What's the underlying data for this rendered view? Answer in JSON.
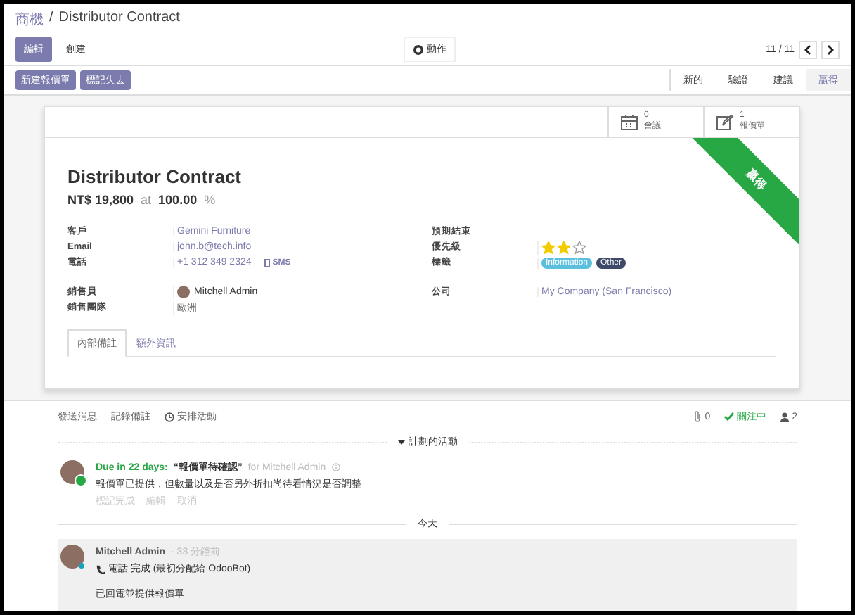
{
  "breadcrumb": {
    "parent": "商機",
    "separator": "/",
    "current": "Distributor Contract"
  },
  "toolbar": {
    "edit": "編輯",
    "create": "創建",
    "action": "動作",
    "pager": "11 / 11"
  },
  "status_buttons": [
    "新建報價單",
    "標記失去"
  ],
  "stages": [
    {
      "label": "新的",
      "selected": false
    },
    {
      "label": "驗證",
      "selected": false
    },
    {
      "label": "建議",
      "selected": false
    },
    {
      "label": "贏得",
      "selected": true
    }
  ],
  "smart_buttons": [
    {
      "kind": "calendar",
      "count": "0",
      "label": "會議"
    },
    {
      "kind": "quote",
      "count": "1",
      "label": "報價單"
    }
  ],
  "ribbon": "贏得",
  "title": "Distributor Contract",
  "revenue": {
    "amount": "NT$ 19,800",
    "at": "at",
    "probability": "100.00",
    "unit": "%"
  },
  "left_fields": [
    {
      "label": "客戶",
      "value": "Gemini Furniture",
      "kind": "link"
    },
    {
      "label": "Email",
      "value": "john.b@tech.info",
      "kind": "link"
    },
    {
      "label": "電話",
      "value": "+1 312 349 2324",
      "kind": "phone",
      "sms": "SMS"
    }
  ],
  "left_fields_2": [
    {
      "label": "銷售員",
      "value": "Mitchell Admin",
      "kind": "user"
    },
    {
      "label": "銷售團隊",
      "value": "歐洲",
      "kind": "text"
    }
  ],
  "right_fields": [
    {
      "label": "預期結束",
      "kind": "empty"
    },
    {
      "label": "優先級",
      "kind": "stars",
      "stars": 2
    },
    {
      "label": "標籤",
      "kind": "tags",
      "tags": [
        {
          "label": "Information",
          "color": "#5bc0de"
        },
        {
          "label": "Other",
          "color": "#3f4a6b"
        }
      ]
    }
  ],
  "right_fields_2": [
    {
      "label": "公司",
      "value": "My Company (San Francisco)",
      "kind": "link"
    }
  ],
  "notebook_tabs": [
    {
      "label": "內部備註",
      "selected": true
    },
    {
      "label": "額外資訊",
      "selected": false
    }
  ],
  "chatter": {
    "actions": [
      "發送消息",
      "記錄備註",
      "安排活動"
    ],
    "attachments": "0",
    "follow": "關注中",
    "followers": "2"
  },
  "planned": {
    "title": "計劃的活動",
    "due": "Due in 22 days:",
    "summary": "“報價單待確認”",
    "for": "for Mitchell Admin",
    "note": "報價單已提供，但數量以及是否另外折扣尚待看情況是否調整",
    "links": [
      "標記完成",
      "編輯",
      "取消"
    ]
  },
  "day_separator": "今天",
  "message": {
    "author": "Mitchell Admin",
    "time": "- 33 分鐘前",
    "activity": "電話 完成 (最初分配給 OdooBot)",
    "body": "已回電並提供報價單"
  }
}
